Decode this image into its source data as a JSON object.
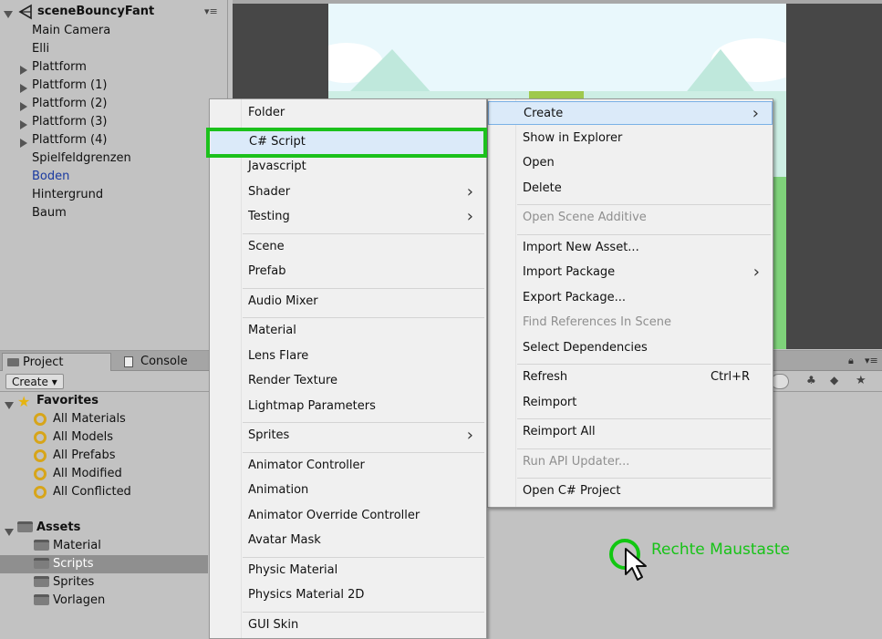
{
  "hierarchy": {
    "scene_name": "sceneBouncyFant",
    "items": [
      {
        "label": "Main Camera",
        "expandable": false,
        "selected": false
      },
      {
        "label": "Elli",
        "expandable": false,
        "selected": false
      },
      {
        "label": "Plattform",
        "expandable": true,
        "selected": false
      },
      {
        "label": "Plattform (1)",
        "expandable": true,
        "selected": false
      },
      {
        "label": "Plattform (2)",
        "expandable": true,
        "selected": false
      },
      {
        "label": "Plattform (3)",
        "expandable": true,
        "selected": false
      },
      {
        "label": "Plattform (4)",
        "expandable": true,
        "selected": false
      },
      {
        "label": "Spielfeldgrenzen",
        "expandable": false,
        "selected": false
      },
      {
        "label": "Boden",
        "expandable": false,
        "selected": true
      },
      {
        "label": "Hintergrund",
        "expandable": false,
        "selected": false
      },
      {
        "label": "Baum",
        "expandable": false,
        "selected": false
      }
    ]
  },
  "project_panel": {
    "tabs": [
      {
        "label": "Project",
        "active": true
      },
      {
        "label": "Console",
        "active": false
      }
    ],
    "create_button": "Create",
    "favorites": {
      "label": "Favorites",
      "items": [
        "All Materials",
        "All Models",
        "All Prefabs",
        "All Modified",
        "All Conflicted"
      ]
    },
    "assets": {
      "label": "Assets",
      "items": [
        {
          "label": "Material",
          "selected": false
        },
        {
          "label": "Scripts",
          "selected": true
        },
        {
          "label": "Sprites",
          "selected": false
        },
        {
          "label": "Vorlagen",
          "selected": false
        }
      ]
    }
  },
  "context_menu": {
    "items": [
      {
        "label": "Create",
        "submenu": true,
        "disabled": false,
        "highlighted": true
      },
      {
        "label": "Show in Explorer"
      },
      {
        "label": "Open"
      },
      {
        "label": "Delete"
      },
      {
        "label": "Open Scene Additive",
        "disabled": true
      },
      {
        "label": "Import New Asset..."
      },
      {
        "label": "Import Package",
        "submenu": true
      },
      {
        "label": "Export Package..."
      },
      {
        "label": "Find References In Scene",
        "disabled": true
      },
      {
        "label": "Select Dependencies"
      },
      {
        "label": "Refresh",
        "shortcut": "Ctrl+R"
      },
      {
        "label": "Reimport"
      },
      {
        "label": "Reimport All"
      },
      {
        "label": "Run API Updater...",
        "disabled": true
      },
      {
        "label": "Open C# Project"
      }
    ]
  },
  "create_submenu": {
    "items": [
      {
        "label": "Folder"
      },
      {
        "label": "C# Script",
        "highlighted": true
      },
      {
        "label": "Javascript"
      },
      {
        "label": "Shader",
        "submenu": true
      },
      {
        "label": "Testing",
        "submenu": true
      },
      {
        "label": "Scene"
      },
      {
        "label": "Prefab"
      },
      {
        "label": "Audio Mixer"
      },
      {
        "label": "Material"
      },
      {
        "label": "Lens Flare"
      },
      {
        "label": "Render Texture"
      },
      {
        "label": "Lightmap Parameters"
      },
      {
        "label": "Sprites",
        "submenu": true
      },
      {
        "label": "Animator Controller"
      },
      {
        "label": "Animation"
      },
      {
        "label": "Animator Override Controller"
      },
      {
        "label": "Avatar Mask"
      },
      {
        "label": "Physic Material"
      },
      {
        "label": "Physics Material 2D"
      },
      {
        "label": "GUI Skin"
      }
    ]
  },
  "annotation": {
    "label": "Rechte Maustaste",
    "color": "#17c317"
  },
  "colors": {
    "panel_bg": "#c2c2c2",
    "selection_bg": "#8f8f8f",
    "selected_hierarchy_text": "#1a3aa0",
    "menu_bg": "#f0f0f0",
    "menu_highlight": "#dbeaf9",
    "highlight_outline": "#1cc11c"
  }
}
